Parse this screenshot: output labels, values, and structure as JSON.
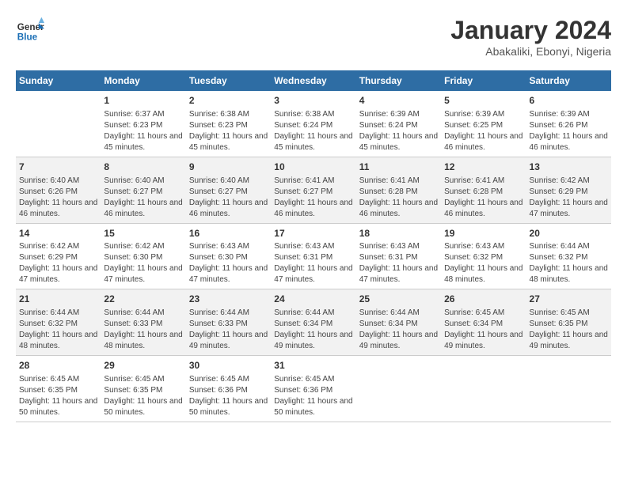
{
  "header": {
    "logo_text_general": "General",
    "logo_text_blue": "Blue",
    "title": "January 2024",
    "subtitle": "Abakaliki, Ebonyi, Nigeria"
  },
  "columns": [
    "Sunday",
    "Monday",
    "Tuesday",
    "Wednesday",
    "Thursday",
    "Friday",
    "Saturday"
  ],
  "weeks": [
    [
      {
        "day": "",
        "sunrise": "",
        "sunset": "",
        "daylight": ""
      },
      {
        "day": "1",
        "sunrise": "Sunrise: 6:37 AM",
        "sunset": "Sunset: 6:23 PM",
        "daylight": "Daylight: 11 hours and 45 minutes."
      },
      {
        "day": "2",
        "sunrise": "Sunrise: 6:38 AM",
        "sunset": "Sunset: 6:23 PM",
        "daylight": "Daylight: 11 hours and 45 minutes."
      },
      {
        "day": "3",
        "sunrise": "Sunrise: 6:38 AM",
        "sunset": "Sunset: 6:24 PM",
        "daylight": "Daylight: 11 hours and 45 minutes."
      },
      {
        "day": "4",
        "sunrise": "Sunrise: 6:39 AM",
        "sunset": "Sunset: 6:24 PM",
        "daylight": "Daylight: 11 hours and 45 minutes."
      },
      {
        "day": "5",
        "sunrise": "Sunrise: 6:39 AM",
        "sunset": "Sunset: 6:25 PM",
        "daylight": "Daylight: 11 hours and 46 minutes."
      },
      {
        "day": "6",
        "sunrise": "Sunrise: 6:39 AM",
        "sunset": "Sunset: 6:26 PM",
        "daylight": "Daylight: 11 hours and 46 minutes."
      }
    ],
    [
      {
        "day": "7",
        "sunrise": "Sunrise: 6:40 AM",
        "sunset": "Sunset: 6:26 PM",
        "daylight": "Daylight: 11 hours and 46 minutes."
      },
      {
        "day": "8",
        "sunrise": "Sunrise: 6:40 AM",
        "sunset": "Sunset: 6:27 PM",
        "daylight": "Daylight: 11 hours and 46 minutes."
      },
      {
        "day": "9",
        "sunrise": "Sunrise: 6:40 AM",
        "sunset": "Sunset: 6:27 PM",
        "daylight": "Daylight: 11 hours and 46 minutes."
      },
      {
        "day": "10",
        "sunrise": "Sunrise: 6:41 AM",
        "sunset": "Sunset: 6:27 PM",
        "daylight": "Daylight: 11 hours and 46 minutes."
      },
      {
        "day": "11",
        "sunrise": "Sunrise: 6:41 AM",
        "sunset": "Sunset: 6:28 PM",
        "daylight": "Daylight: 11 hours and 46 minutes."
      },
      {
        "day": "12",
        "sunrise": "Sunrise: 6:41 AM",
        "sunset": "Sunset: 6:28 PM",
        "daylight": "Daylight: 11 hours and 46 minutes."
      },
      {
        "day": "13",
        "sunrise": "Sunrise: 6:42 AM",
        "sunset": "Sunset: 6:29 PM",
        "daylight": "Daylight: 11 hours and 47 minutes."
      }
    ],
    [
      {
        "day": "14",
        "sunrise": "Sunrise: 6:42 AM",
        "sunset": "Sunset: 6:29 PM",
        "daylight": "Daylight: 11 hours and 47 minutes."
      },
      {
        "day": "15",
        "sunrise": "Sunrise: 6:42 AM",
        "sunset": "Sunset: 6:30 PM",
        "daylight": "Daylight: 11 hours and 47 minutes."
      },
      {
        "day": "16",
        "sunrise": "Sunrise: 6:43 AM",
        "sunset": "Sunset: 6:30 PM",
        "daylight": "Daylight: 11 hours and 47 minutes."
      },
      {
        "day": "17",
        "sunrise": "Sunrise: 6:43 AM",
        "sunset": "Sunset: 6:31 PM",
        "daylight": "Daylight: 11 hours and 47 minutes."
      },
      {
        "day": "18",
        "sunrise": "Sunrise: 6:43 AM",
        "sunset": "Sunset: 6:31 PM",
        "daylight": "Daylight: 11 hours and 47 minutes."
      },
      {
        "day": "19",
        "sunrise": "Sunrise: 6:43 AM",
        "sunset": "Sunset: 6:32 PM",
        "daylight": "Daylight: 11 hours and 48 minutes."
      },
      {
        "day": "20",
        "sunrise": "Sunrise: 6:44 AM",
        "sunset": "Sunset: 6:32 PM",
        "daylight": "Daylight: 11 hours and 48 minutes."
      }
    ],
    [
      {
        "day": "21",
        "sunrise": "Sunrise: 6:44 AM",
        "sunset": "Sunset: 6:32 PM",
        "daylight": "Daylight: 11 hours and 48 minutes."
      },
      {
        "day": "22",
        "sunrise": "Sunrise: 6:44 AM",
        "sunset": "Sunset: 6:33 PM",
        "daylight": "Daylight: 11 hours and 48 minutes."
      },
      {
        "day": "23",
        "sunrise": "Sunrise: 6:44 AM",
        "sunset": "Sunset: 6:33 PM",
        "daylight": "Daylight: 11 hours and 49 minutes."
      },
      {
        "day": "24",
        "sunrise": "Sunrise: 6:44 AM",
        "sunset": "Sunset: 6:34 PM",
        "daylight": "Daylight: 11 hours and 49 minutes."
      },
      {
        "day": "25",
        "sunrise": "Sunrise: 6:44 AM",
        "sunset": "Sunset: 6:34 PM",
        "daylight": "Daylight: 11 hours and 49 minutes."
      },
      {
        "day": "26",
        "sunrise": "Sunrise: 6:45 AM",
        "sunset": "Sunset: 6:34 PM",
        "daylight": "Daylight: 11 hours and 49 minutes."
      },
      {
        "day": "27",
        "sunrise": "Sunrise: 6:45 AM",
        "sunset": "Sunset: 6:35 PM",
        "daylight": "Daylight: 11 hours and 49 minutes."
      }
    ],
    [
      {
        "day": "28",
        "sunrise": "Sunrise: 6:45 AM",
        "sunset": "Sunset: 6:35 PM",
        "daylight": "Daylight: 11 hours and 50 minutes."
      },
      {
        "day": "29",
        "sunrise": "Sunrise: 6:45 AM",
        "sunset": "Sunset: 6:35 PM",
        "daylight": "Daylight: 11 hours and 50 minutes."
      },
      {
        "day": "30",
        "sunrise": "Sunrise: 6:45 AM",
        "sunset": "Sunset: 6:36 PM",
        "daylight": "Daylight: 11 hours and 50 minutes."
      },
      {
        "day": "31",
        "sunrise": "Sunrise: 6:45 AM",
        "sunset": "Sunset: 6:36 PM",
        "daylight": "Daylight: 11 hours and 50 minutes."
      },
      {
        "day": "",
        "sunrise": "",
        "sunset": "",
        "daylight": ""
      },
      {
        "day": "",
        "sunrise": "",
        "sunset": "",
        "daylight": ""
      },
      {
        "day": "",
        "sunrise": "",
        "sunset": "",
        "daylight": ""
      }
    ]
  ]
}
